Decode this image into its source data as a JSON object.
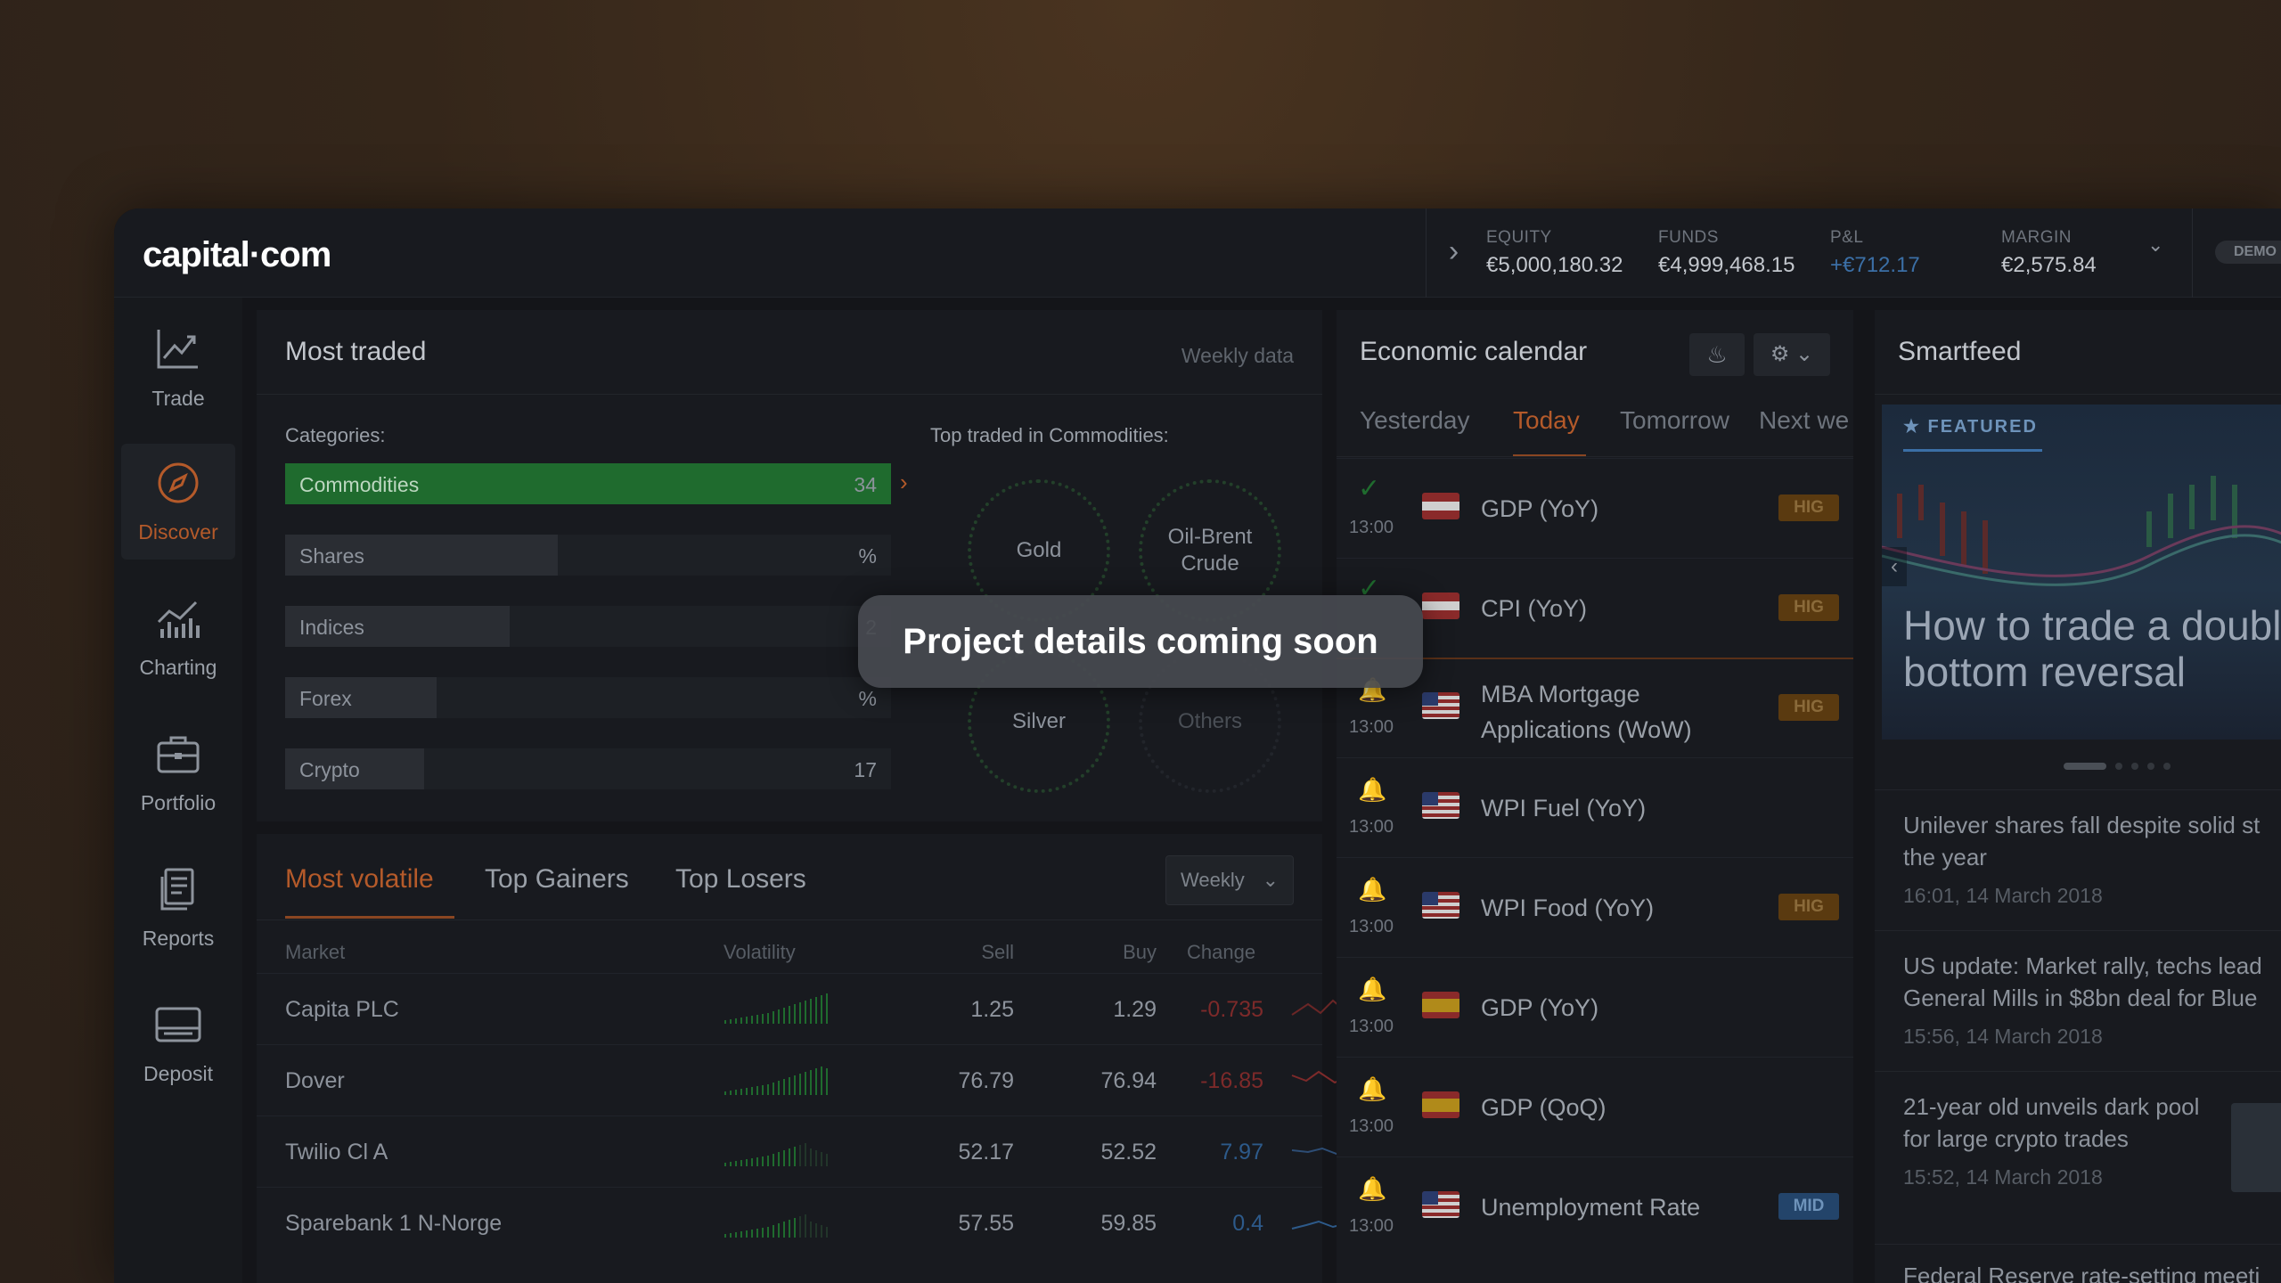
{
  "app": {
    "logo": "capital·com",
    "account": {
      "equity_label": "EQUITY",
      "equity_value": "€5,000,180.32",
      "funds_label": "FUNDS",
      "funds_value": "€4,999,468.15",
      "pnl_label": "P&L",
      "pnl_value": "+€712.17",
      "margin_label": "MARGIN",
      "margin_value": "€2,575.84"
    },
    "demo_badge": "DEMO"
  },
  "sidebar": {
    "items": [
      {
        "label": "Trade",
        "icon": "trade-chart-icon"
      },
      {
        "label": "Discover",
        "icon": "compass-icon"
      },
      {
        "label": "Charting",
        "icon": "bar-chart-icon"
      },
      {
        "label": "Portfolio",
        "icon": "briefcase-icon"
      },
      {
        "label": "Reports",
        "icon": "document-icon"
      },
      {
        "label": "Deposit",
        "icon": "card-icon"
      }
    ]
  },
  "most_traded": {
    "title": "Most traded",
    "period": "Weekly data",
    "categories_label": "Categories:",
    "categories": [
      {
        "name": "Commodities",
        "value": "34",
        "fill": 1.0
      },
      {
        "name": "Shares",
        "value": "%",
        "fill": 0.45
      },
      {
        "name": "Indices",
        "value": "2",
        "fill": 0.37
      },
      {
        "name": "Forex",
        "value": "%",
        "fill": 0.25
      },
      {
        "name": "Crypto",
        "value": "17",
        "fill": 0.23
      }
    ],
    "top_traded_label": "Top traded in Commodities:",
    "top_items": [
      "Gold",
      "Oil-Brent Crude",
      "Silver",
      "Others"
    ]
  },
  "volatile": {
    "tabs": [
      "Most volatile",
      "Top Gainers",
      "Top Losers"
    ],
    "period_select": "Weekly",
    "columns": [
      "Market",
      "Volatility",
      "Sell",
      "Buy",
      "Change"
    ],
    "rows": [
      {
        "market": "Capita PLC",
        "sell": "1.25",
        "buy": "1.29",
        "change": "-0.735",
        "dir": "neg"
      },
      {
        "market": "Dover",
        "sell": "76.79",
        "buy": "76.94",
        "change": "-16.85",
        "dir": "neg"
      },
      {
        "market": "Twilio Cl A",
        "sell": "52.17",
        "buy": "52.52",
        "change": "7.97",
        "dir": "pos"
      },
      {
        "market": "Sparebank 1 N-Norge",
        "sell": "57.55",
        "buy": "59.85",
        "change": "0.4",
        "dir": "pos"
      }
    ]
  },
  "calendar": {
    "title": "Economic calendar",
    "tabs": [
      "Yesterday",
      "Today",
      "Tomorrow",
      "Next we"
    ],
    "events": [
      {
        "time": "13:00",
        "name": "GDP (YoY)",
        "country": "AT",
        "impact": "HIG",
        "status": "check-icon"
      },
      {
        "time": "",
        "name": "CPI (YoY)",
        "country": "AT",
        "impact": "HIG",
        "status": "check-icon"
      },
      {
        "time": "13:00",
        "name": "MBA Mortgage Applications (WoW)",
        "country": "US",
        "impact": "HIG",
        "status": "bell-icon"
      },
      {
        "time": "13:00",
        "name": "WPI Fuel (YoY)",
        "country": "US",
        "impact": "",
        "status": "bell-icon"
      },
      {
        "time": "13:00",
        "name": "WPI Food (YoY)",
        "country": "US",
        "impact": "HIG",
        "status": "bell-icon"
      },
      {
        "time": "13:00",
        "name": "GDP (YoY)",
        "country": "ES",
        "impact": "",
        "status": "bell-icon"
      },
      {
        "time": "13:00",
        "name": "GDP (QoQ)",
        "country": "ES",
        "impact": "",
        "status": "bell-icon"
      },
      {
        "time": "13:00",
        "name": "Unemployment Rate",
        "country": "US",
        "impact": "MID",
        "status": "bell-icon"
      }
    ]
  },
  "smartfeed": {
    "title": "Smartfeed",
    "featured_label": "FEATURED",
    "featured_title": "How to trade a double bottom reversal",
    "items": [
      {
        "title": "Unilever shares fall despite solid st the year",
        "time": "16:01, 14 March 2018"
      },
      {
        "title": "US update: Market rally, techs lead General Mills in $8bn deal for Blue",
        "time": "15:56, 14 March 2018"
      },
      {
        "title": "21-year old unveils dark pool for large crypto trades",
        "time": "15:52, 14 March 2018"
      },
      {
        "title": "Federal Reserve rate-setting meeti",
        "time": ""
      }
    ]
  },
  "toast": {
    "message": "Project details coming soon"
  },
  "colors": {
    "accent": "#b45a2a",
    "positive": "#2d5a8a",
    "negative": "#7d2a2a",
    "highlight_green": "#1f6b2e"
  }
}
